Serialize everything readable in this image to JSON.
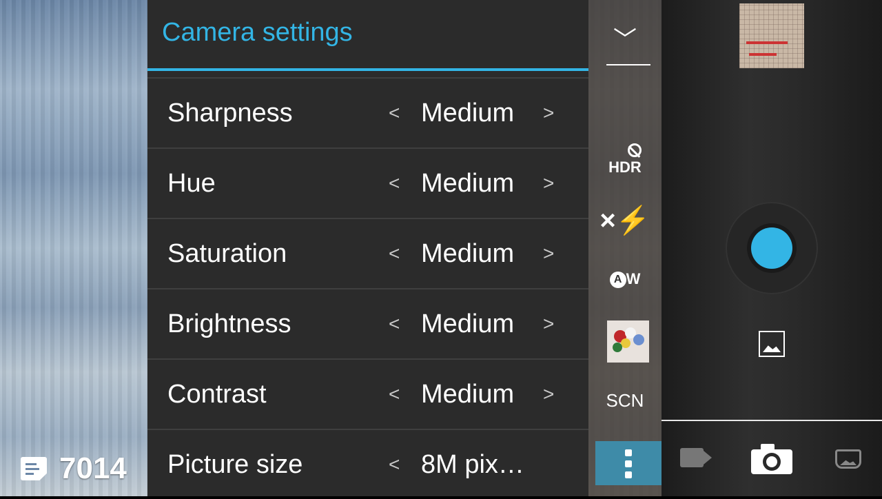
{
  "preview": {
    "image_counter": "7014"
  },
  "panel": {
    "title": "Camera settings",
    "rows": [
      {
        "label": "Sharpness",
        "value": "Medium",
        "prev": "<",
        "next": ">"
      },
      {
        "label": "Hue",
        "value": "Medium",
        "prev": "<",
        "next": ">"
      },
      {
        "label": "Saturation",
        "value": "Medium",
        "prev": "<",
        "next": ">"
      },
      {
        "label": "Brightness",
        "value": "Medium",
        "prev": "<",
        "next": ">"
      },
      {
        "label": "Contrast",
        "value": "Medium",
        "prev": "<",
        "next": ">"
      },
      {
        "label": "Picture size",
        "value": "8M pix…",
        "prev": "<",
        "next": ""
      }
    ]
  },
  "quickbar": {
    "collapse_glyph": "﹀",
    "hdr_label": "HDR",
    "flash_glyph": "×⚡",
    "awb_a": "A",
    "awb_w": "W",
    "scene_label": "SCN"
  },
  "colors": {
    "accent": "#33b5e5",
    "panel_bg": "#2b2b2b",
    "divider": "#3f3f3f"
  },
  "icons": {
    "header": "chevron-down-icon",
    "hdr": "hdr-off-icon",
    "flash": "flash-off-icon",
    "white_balance": "auto-white-balance-icon",
    "scene": "scene-mode-thumbnail",
    "more": "more-vertical-icon",
    "gallery": "gallery-icon",
    "modes": [
      "video-mode-icon",
      "camera-mode-icon",
      "panorama-mode-icon"
    ]
  }
}
